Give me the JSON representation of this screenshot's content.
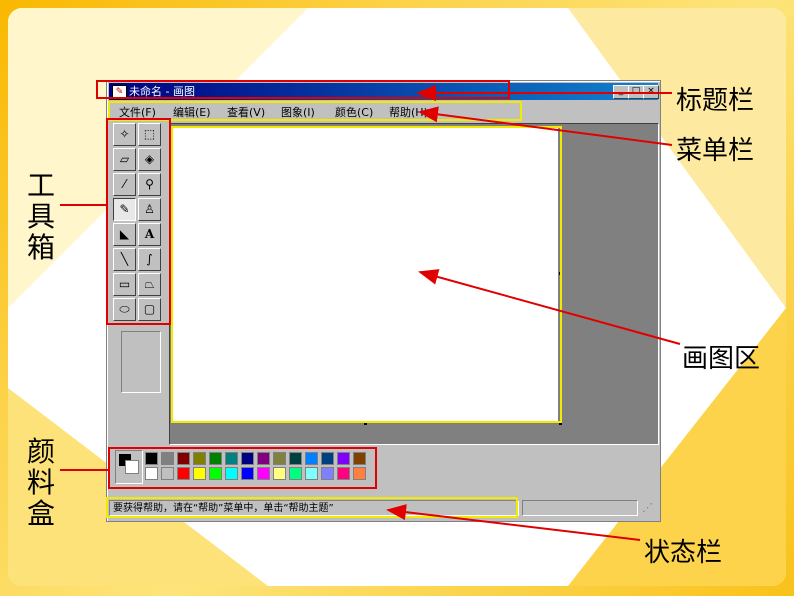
{
  "window": {
    "title": "未命名 - 画图",
    "menus": [
      "文件(F)",
      "编辑(E)",
      "查看(V)",
      "图象(I)",
      "颜色(C)",
      "帮助(H)"
    ],
    "status_text": "要获得帮助，请在“帮助”菜单中，单击“帮助主题”"
  },
  "palette": {
    "row1": [
      "#000000",
      "#808080",
      "#800000",
      "#808000",
      "#008000",
      "#008080",
      "#000080",
      "#800080",
      "#808040",
      "#004040",
      "#0080ff",
      "#004080",
      "#8000ff",
      "#804000"
    ],
    "row2": [
      "#ffffff",
      "#c0c0c0",
      "#ff0000",
      "#ffff00",
      "#00ff00",
      "#00ffff",
      "#0000ff",
      "#ff00ff",
      "#ffff80",
      "#00ff80",
      "#80ffff",
      "#8080ff",
      "#ff0080",
      "#ff8040"
    ]
  },
  "annotations": {
    "title_bar": "标题栏",
    "menu_bar": "菜单栏",
    "toolbox": "工具箱",
    "drawing_area": "画图区",
    "color_box": "颜料盒",
    "status_bar": "状态栏"
  },
  "colors": {
    "annotation_red": "#e00000",
    "annotation_yellow": "#f2ea00",
    "title_blue": "#000080"
  }
}
